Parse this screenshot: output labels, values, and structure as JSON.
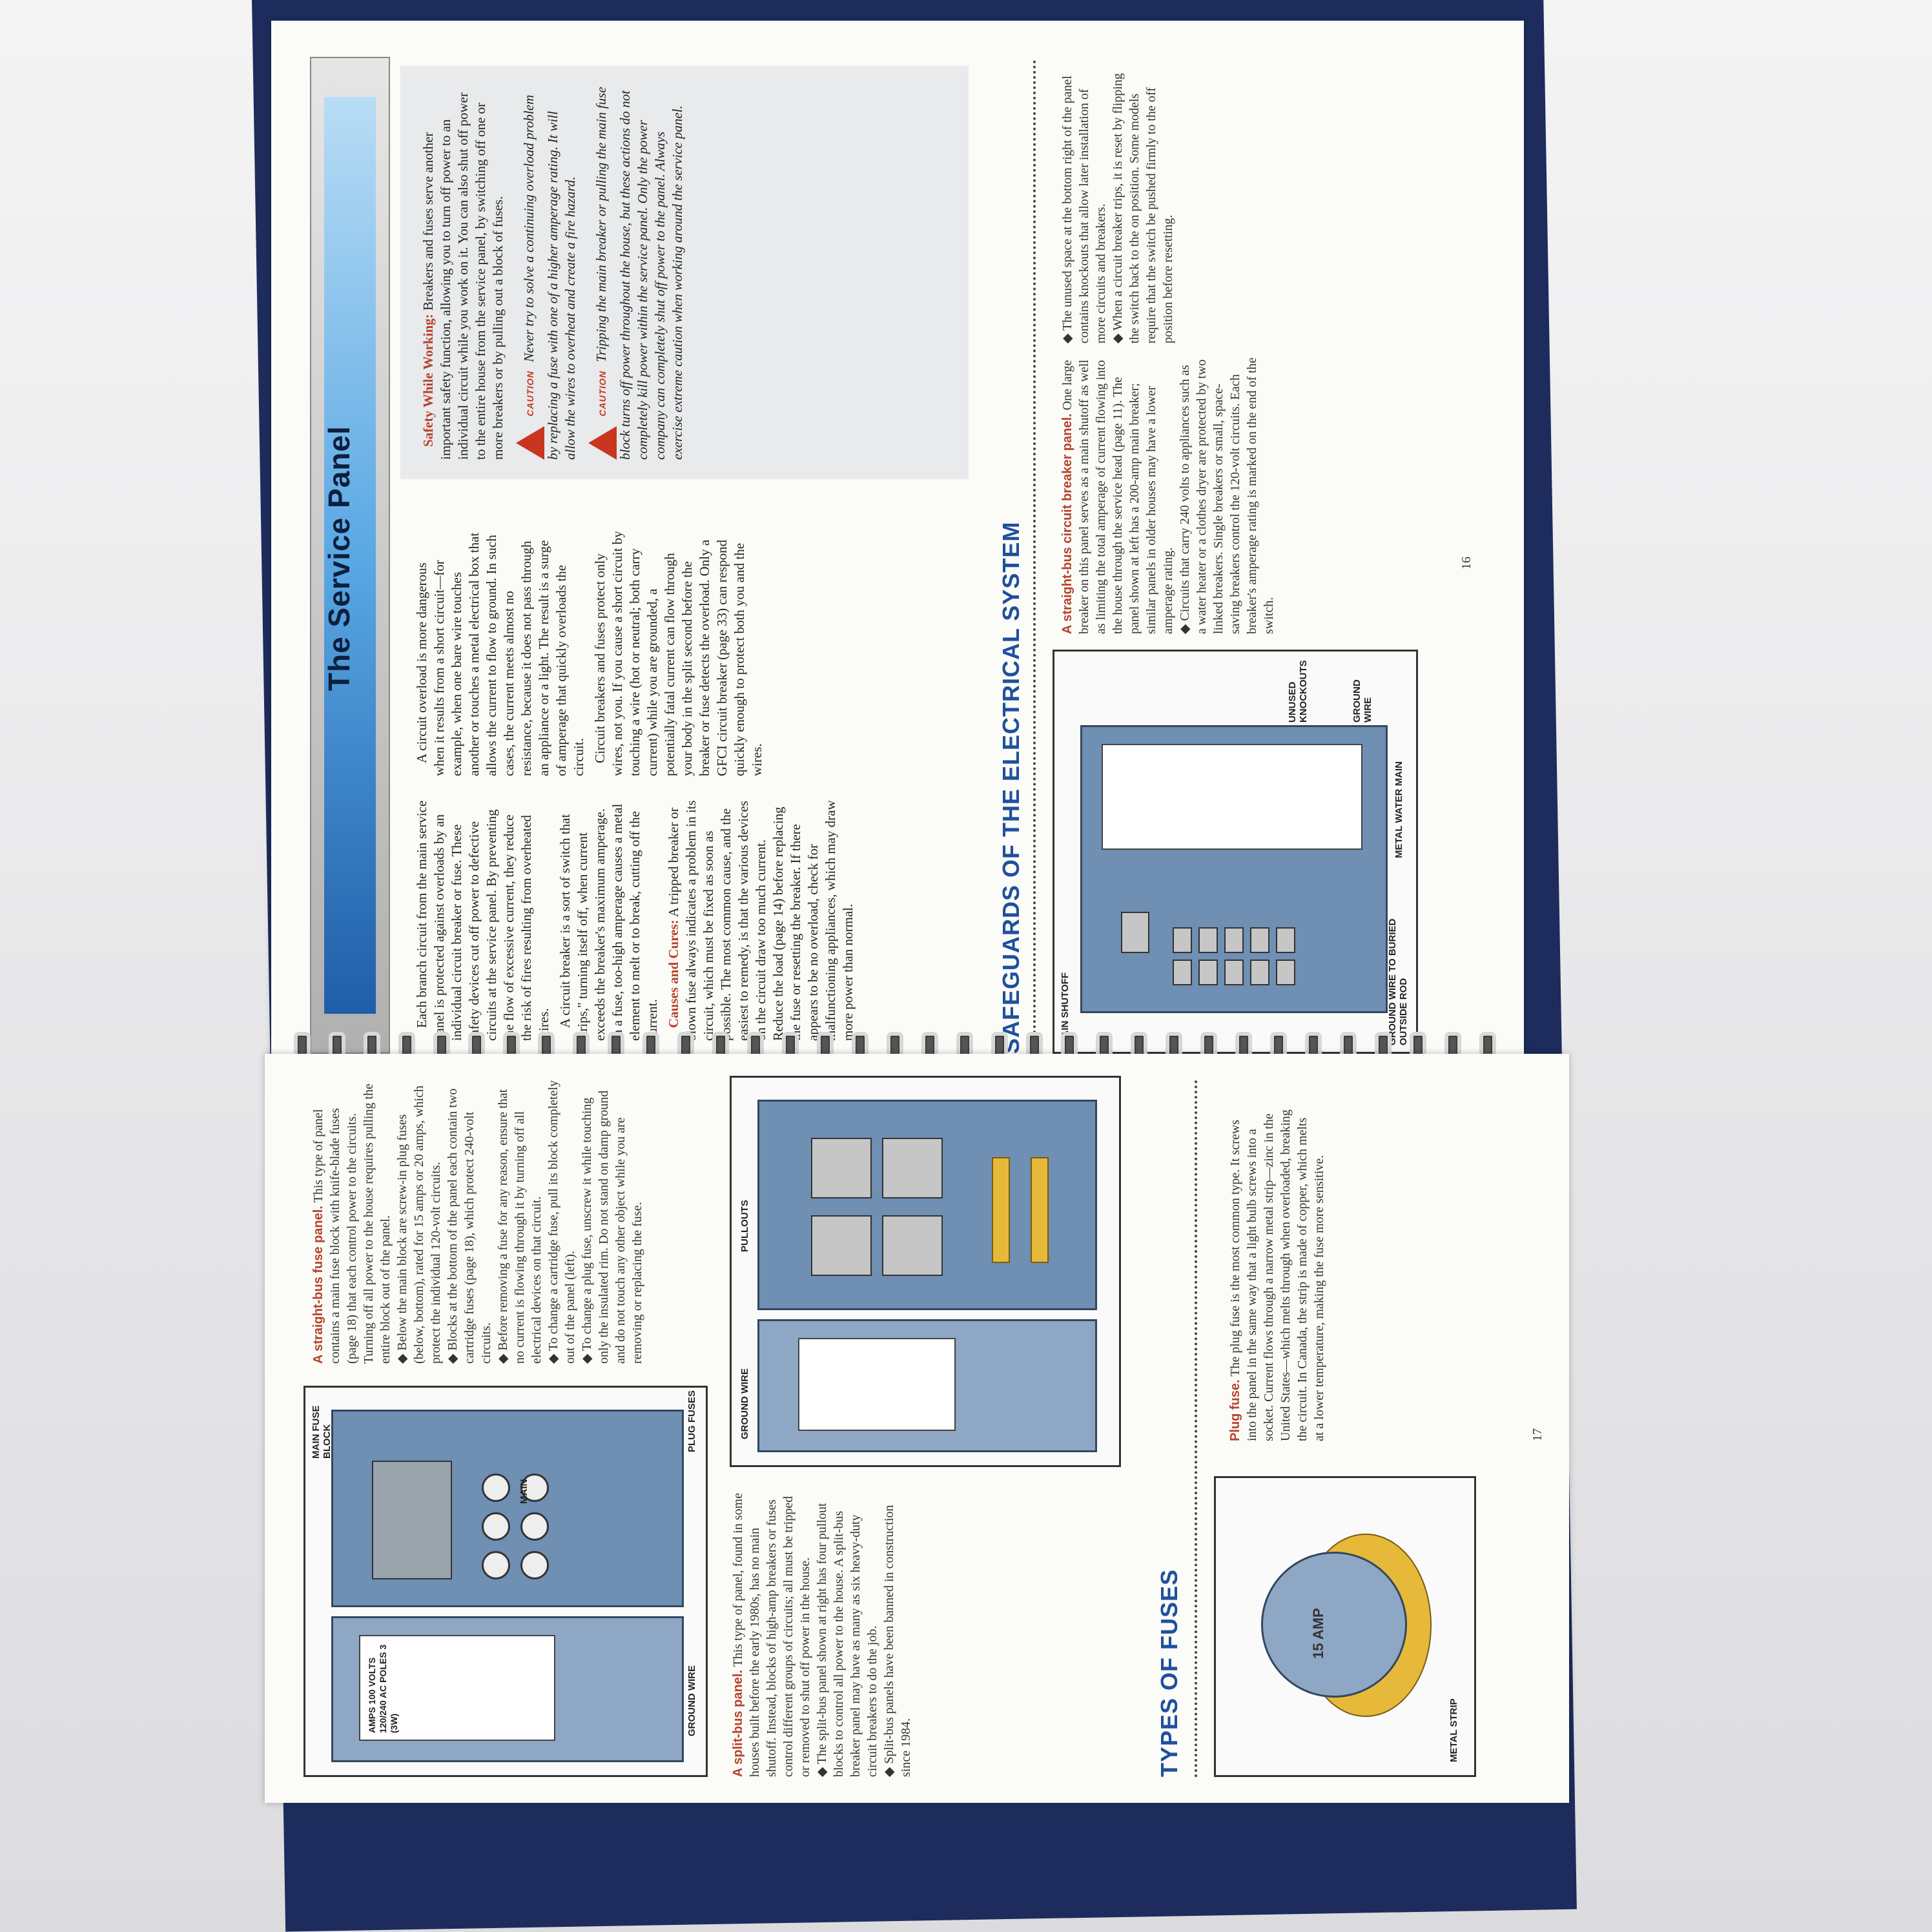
{
  "left_page": {
    "title": "The Service Panel",
    "intro": "Each branch circuit from the main service panel is protected against overloads by an individual circuit breaker or fuse. These safety devices cut off power to defective circuits at the service panel. By preventing the flow of excessive current, they reduce the risk of fires resulting from overheated wires.",
    "p2": "A circuit breaker is a sort of switch that \"trips,\" turning itself off, when current exceeds the breaker's maximum amperage. In a fuse, too-high amperage causes a metal element to melt or to break, cutting off the current.",
    "causes_head": "Causes and Cures:",
    "causes_body": "A tripped breaker or blown fuse always indicates a problem in its circuit, which must be fixed as soon as possible. The most common cause, and the easiest to remedy, is that the various devices on the circuit draw too much current. Reduce the load (page 14) before replacing the fuse or resetting the breaker. If there appears to be no overload, check for malfunctioning appliances, which may draw more power than normal.",
    "p4": "A circuit overload is more dangerous when it results from a short circuit—for example, when one bare wire touches another or touches a metal electrical box that allows the current to flow to ground. In such cases, the current meets almost no resistance, because it does not pass through an appliance or a light. The result is a surge of amperage that quickly overloads the circuit.",
    "p5": "Circuit breakers and fuses protect only wires, not you. If you cause a short circuit by touching a wire (hot or neutral; both carry current) while you are grounded, a potentially fatal current can flow through your body in the split second before the breaker or fuse detects the overload. Only a GFCI circuit breaker (page 33) can respond quickly enough to protect both you and the wires.",
    "safety_head": "Safety While Working:",
    "safety_body": "Breakers and fuses serve another important safety function, allowing you to turn off power to an individual circuit while you work on it. You can also shut off power to the entire house from the service panel, by switching off one or more breakers or by pulling out a block of fuses.",
    "caution_word": "CAUTION",
    "caution1": "Never try to solve a continuing overload problem by replacing a fuse with one of a higher amperage rating. It will allow the wires to overheat and create a fire hazard.",
    "caution2": "Tripping the main breaker or pulling the main fuse block turns off power throughout the house, but these actions do not completely kill power within the service panel. Only the power company can completely shut off power to the panel. Always exercise extreme caution when working around the service panel.",
    "section_head": "SAFEGUARDS OF THE ELECTRICAL SYSTEM",
    "fig_callouts": [
      "MAIN SHUTOFF",
      "UNUSED KNOCKOUTS",
      "GROUND WIRE",
      "GROUND WIRE TO BURIED OUTSIDE ROD",
      "METAL WATER MAIN"
    ],
    "fig_caption_head": "A straight-bus circuit breaker panel.",
    "fig_caption": "One large breaker on this panel serves as a main shutoff as well as limiting the total amperage of current flowing into the house through the service head (page 11). The panel shown at left has a 200-amp main breaker; similar panels in older houses may have a lower amperage rating.",
    "fig_bullets": [
      "Circuits that carry 240 volts to appliances such as a water heater or a clothes dryer are protected by two linked breakers. Single breakers or small, space-saving breakers control the 120-volt circuits. Each breaker's amperage rating is marked on the end of the switch.",
      "The unused space at the bottom right of the panel contains knockouts that allow later installation of more circuits and breakers.",
      "When a circuit breaker trips, it is reset by flipping the switch back to the on position. Some models require that the switch be pushed firmly to the off position before resetting."
    ],
    "page_number": "16"
  },
  "right_page": {
    "fig1_callouts": [
      "MAIN FUSE BLOCK",
      "PLUG FUSES",
      "MAIN",
      "GROUND WIRE"
    ],
    "fig1_label": "AMPS 100 VOLTS 120/240 AC POLES 3 (3W)",
    "fig1_caption_head": "A straight-bus fuse panel.",
    "fig1_caption": "This type of panel contains a main fuse block with knife-blade fuses (page 18) that each control power to the circuits. Turning off all power to the house requires pulling the entire block out of the panel.",
    "fig1_bullets": [
      "Below the main block are screw-in plug fuses (below, bottom), rated for 15 amps or 20 amps, which protect the individual 120-volt circuits.",
      "Blocks at the bottom of the panel each contain two cartridge fuses (page 18), which protect 240-volt circuits.",
      "Before removing a fuse for any reason, ensure that no current is flowing through it by turning off all electrical devices on that circuit.",
      "To change a cartridge fuse, pull its block completely out of the panel (left).",
      "To change a plug fuse, unscrew it while touching only the insulated rim. Do not stand on damp ground and do not touch any other object while you are removing or replacing the fuse."
    ],
    "fig2_callouts": [
      "PULLOUTS",
      "GROUND WIRE"
    ],
    "fig2_caption_head": "A split-bus panel.",
    "fig2_caption": "This type of panel, found in some houses built before the early 1980s, has no main shutoff. Instead, blocks of high-amp breakers or fuses control different groups of circuits; all must be tripped or removed to shut off power in the house.",
    "fig2_bullets": [
      "The split-bus panel shown at right has four pullout blocks to control all power to the house. A split-bus breaker panel may have as many as six heavy-duty circuit breakers to do the job.",
      "Split-bus panels have been banned in construction since 1984."
    ],
    "section_head": "TYPES OF FUSES",
    "fuse_callout": "METAL STRIP",
    "fuse_marking": "15 AMP",
    "fuse_caption_head": "Plug fuse.",
    "fuse_caption": "The plug fuse is the most common type. It screws into the panel in the same way that a light bulb screws into a socket. Current flows through a narrow metal strip—zinc in the United States—which melts through when overloaded, breaking the circuit. In Canada, the strip is made of copper, which melts at a lower temperature, making the fuse more sensitive.",
    "page_number": "17"
  },
  "colors": {
    "accent_red": "#b6422b",
    "heading_blue": "#1f4f9e",
    "panel_blue": "#6f8fb3",
    "binder_navy": "#1d2c5c"
  }
}
